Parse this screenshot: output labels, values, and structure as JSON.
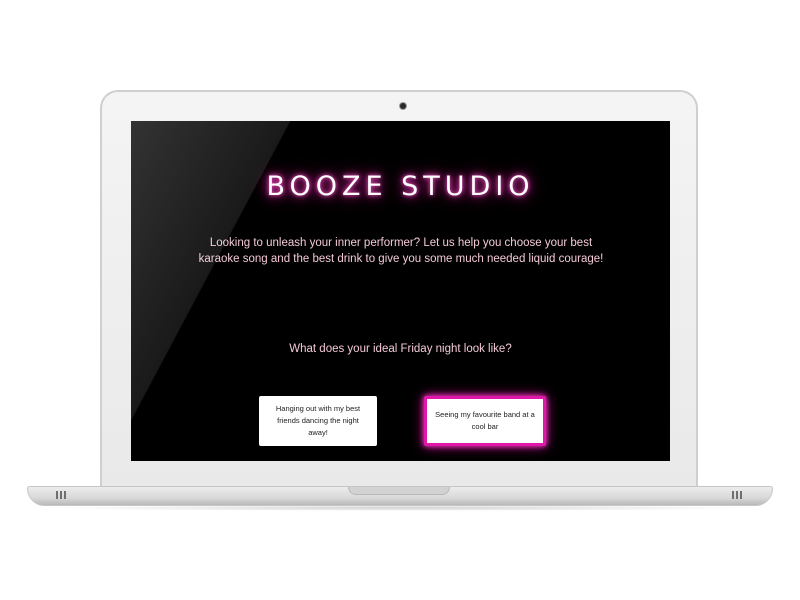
{
  "app": {
    "title": "BOOZE STUDIO",
    "intro": "Looking to unleash your inner performer? Let us help you choose your best karaoke song and the best drink to give you some much needed liquid courage!",
    "question": "What does your ideal Friday night look like?",
    "answers": [
      {
        "label": "Hanging out with my best friends dancing the night away!",
        "selected": false
      },
      {
        "label": "Seeing my favourite band at a cool bar",
        "selected": true
      }
    ]
  },
  "colors": {
    "screen_bg": "#000000",
    "title_glow": "#e0249c",
    "text_pink": "#f3c9d8",
    "selected_border": "#e017a8"
  }
}
